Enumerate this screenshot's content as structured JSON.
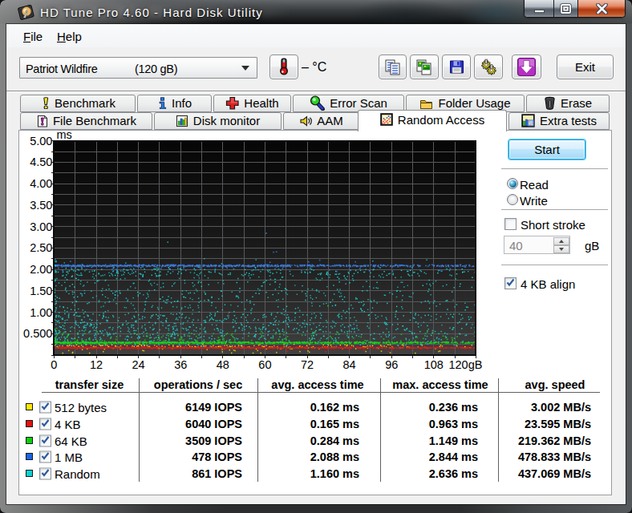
{
  "window": {
    "title": "HD Tune Pro 4.60 - Hard Disk Utility"
  },
  "menu": {
    "items": [
      {
        "first": "F",
        "rest": "ile"
      },
      {
        "first": "H",
        "rest": "elp"
      }
    ]
  },
  "toolbar": {
    "device": "Patriot Wildfire",
    "capacity": "(120 gB)",
    "temperature": "– °C",
    "exit_label": "Exit",
    "icons": [
      "thermometer-icon",
      "copy-text-icon",
      "copy-image-icon",
      "save-icon",
      "gears-icon",
      "download-arrow-icon"
    ]
  },
  "tabs": {
    "row1": [
      {
        "label": "Benchmark",
        "icon": "exclaim"
      },
      {
        "label": "Info",
        "icon": "info"
      },
      {
        "label": "Health",
        "icon": "health"
      },
      {
        "label": "Error Scan",
        "icon": "lens"
      },
      {
        "label": "Folder Usage",
        "icon": "folder"
      },
      {
        "label": "Erase",
        "icon": "trash"
      }
    ],
    "row2": [
      {
        "label": "File Benchmark",
        "icon": "filebench"
      },
      {
        "label": "Disk monitor",
        "icon": "diskmon"
      },
      {
        "label": "AAM",
        "icon": "speaker"
      },
      {
        "label": "Random Access",
        "icon": "scattericon",
        "selected": true
      },
      {
        "label": "Extra tests",
        "icon": "extratests"
      }
    ],
    "selected": "Random Access"
  },
  "controls": {
    "start_label": "Start",
    "read_label": "Read",
    "write_label": "Write",
    "read_selected": true,
    "write_selected": false,
    "short_stroke_label": "Short stroke",
    "short_stroke_checked": false,
    "stroke_value": "40",
    "stroke_unit": "gB",
    "align_label": "4 KB align",
    "align_checked": true
  },
  "chart_data": {
    "type": "scatter",
    "ylabel": "ms",
    "x_unit": "gB",
    "ylim": [
      0,
      5
    ],
    "xlim": [
      0,
      120
    ],
    "y_ticks": [
      "5.00",
      "4.50",
      "4.00",
      "3.50",
      "3.00",
      "2.50",
      "2.00",
      "1.50",
      "1.00",
      "0.500"
    ],
    "x_ticks": [
      "0",
      "12",
      "24",
      "36",
      "48",
      "60",
      "72",
      "84",
      "96",
      "108",
      "120gB"
    ],
    "grid": {
      "x_step_gB": 6,
      "y_step_ms": 0.25
    },
    "density_fade": 0.62,
    "series": [
      {
        "name": "512 bytes",
        "color": "#f0e40c",
        "avg_ms": 0.162,
        "max_ms": 0.236,
        "band": [
          0.13,
          0.26
        ],
        "count": 330,
        "kind": "band",
        "below": [
          0.04,
          0.13,
          28
        ],
        "r": 0.75
      },
      {
        "name": "Random",
        "color": "#1fd3d3",
        "avg_ms": 1.16,
        "max_ms": 2.636,
        "pools": [
          [
            0.3,
            2.02,
            0.6
          ],
          [
            0.34,
            0.95,
            0.25
          ],
          [
            1.84,
            2.05,
            0.1
          ],
          [
            0.2,
            0.33,
            0.05
          ]
        ],
        "band": [
          0.3,
          2.03
        ],
        "count": 1600,
        "kind": "scatter",
        "high": [
          2.06,
          2.3,
          10
        ],
        "r": 0.72
      },
      {
        "name": "64 KB",
        "color": "#1bd51b",
        "avg_ms": 0.284,
        "max_ms": 1.149,
        "band": [
          0.268,
          0.312
        ],
        "count": 1250,
        "kind": "band",
        "high": [
          0.33,
          0.55,
          110
        ],
        "r": 0.8
      },
      {
        "name": "4 KB",
        "color": "#ef1414",
        "avg_ms": 0.165,
        "max_ms": 0.963,
        "band": [
          0.152,
          0.186
        ],
        "count": 1250,
        "kind": "band",
        "below": [
          0.05,
          0.12,
          4
        ],
        "r": 0.8
      },
      {
        "name": "1 MB",
        "color": "#3d7ce0",
        "avg_ms": 2.088,
        "max_ms": 2.844,
        "band": [
          2.058,
          2.112
        ],
        "count": 1020,
        "below": [
          1.95,
          2.04,
          30
        ],
        "kind": "band",
        "high": [
          2.16,
          2.42,
          8
        ],
        "r": 0.8
      }
    ]
  },
  "table": {
    "headers": [
      "transfer size",
      "operations / sec",
      "avg. access time",
      "max. access time",
      "avg. speed"
    ],
    "rows": [
      {
        "color": "#ffe800",
        "label": "512 bytes",
        "ops": "6149 IOPS",
        "avg": "0.162 ms",
        "max": "0.236 ms",
        "speed": "3.002 MB/s",
        "checked": true
      },
      {
        "color": "#e81010",
        "label": "4 KB",
        "ops": "6040 IOPS",
        "avg": "0.165 ms",
        "max": "0.963 ms",
        "speed": "23.595 MB/s",
        "checked": true
      },
      {
        "color": "#0cd00c",
        "label": "64 KB",
        "ops": "3509 IOPS",
        "avg": "0.284 ms",
        "max": "1.149 ms",
        "speed": "219.362 MB/s",
        "checked": true
      },
      {
        "color": "#1766e8",
        "label": "1 MB",
        "ops": "478 IOPS",
        "avg": "2.088 ms",
        "max": "2.844 ms",
        "speed": "478.833 MB/s",
        "checked": true
      },
      {
        "color": "#0cd2d2",
        "label": "Random",
        "ops": "861 IOPS",
        "avg": "1.160 ms",
        "max": "2.636 ms",
        "speed": "437.069 MB/s",
        "checked": true
      }
    ]
  }
}
